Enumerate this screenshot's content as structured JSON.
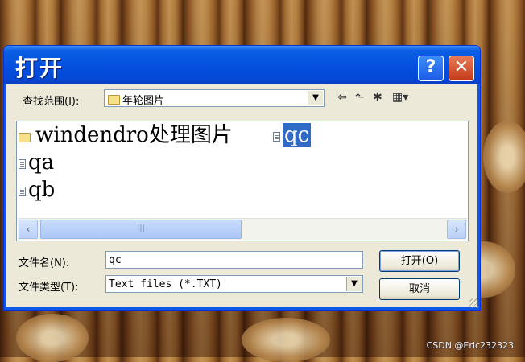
{
  "dialog": {
    "title": "打开",
    "help_glyph": "?",
    "close_glyph": "✕"
  },
  "lookin": {
    "label": "查找范围(I):",
    "value": "年轮图片",
    "nav_icons": [
      "back-arrow-icon",
      "up-folder-icon",
      "new-folder-icon",
      "view-menu-icon"
    ]
  },
  "files": {
    "items": [
      {
        "name": "windendro处理图片",
        "type": "folder",
        "selected": false
      },
      {
        "name": "qc",
        "type": "file",
        "selected": true
      },
      {
        "name": "qa",
        "type": "file",
        "selected": false
      },
      {
        "name": "qb",
        "type": "file",
        "selected": false
      }
    ],
    "scroll_grip": "|||"
  },
  "filename": {
    "label": "文件名(N):",
    "value": "qc"
  },
  "filetype": {
    "label": "文件类型(T):",
    "value": "Text files (*.TXT)"
  },
  "buttons": {
    "open": "打开(O)",
    "cancel": "取消"
  },
  "watermark": "CSDN @Eric232323"
}
